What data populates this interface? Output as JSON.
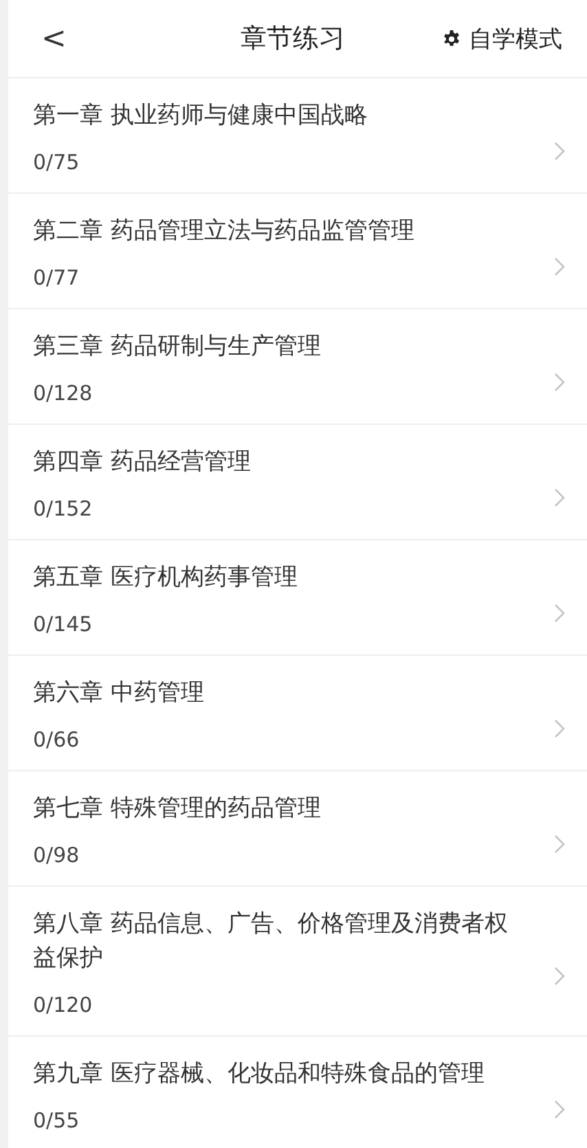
{
  "header": {
    "back": "<",
    "title": "章节练习",
    "mode_button": "自学模式"
  },
  "chapters": [
    {
      "title": "第一章 执业药师与健康中国战略",
      "progress": "0/75"
    },
    {
      "title": "第二章 药品管理立法与药品监管管理",
      "progress": "0/77"
    },
    {
      "title": "第三章 药品研制与生产管理",
      "progress": "0/128"
    },
    {
      "title": "第四章 药品经营管理",
      "progress": "0/152"
    },
    {
      "title": "第五章 医疗机构药事管理",
      "progress": "0/145"
    },
    {
      "title": "第六章 中药管理",
      "progress": "0/66"
    },
    {
      "title": "第七章 特殊管理的药品管理",
      "progress": "0/98"
    },
    {
      "title": "第八章 药品信息、广告、价格管理及消费者权益保护",
      "progress": "0/120"
    },
    {
      "title": "第九章 医疗器械、化妆品和特殊食品的管理",
      "progress": "0/55"
    }
  ]
}
